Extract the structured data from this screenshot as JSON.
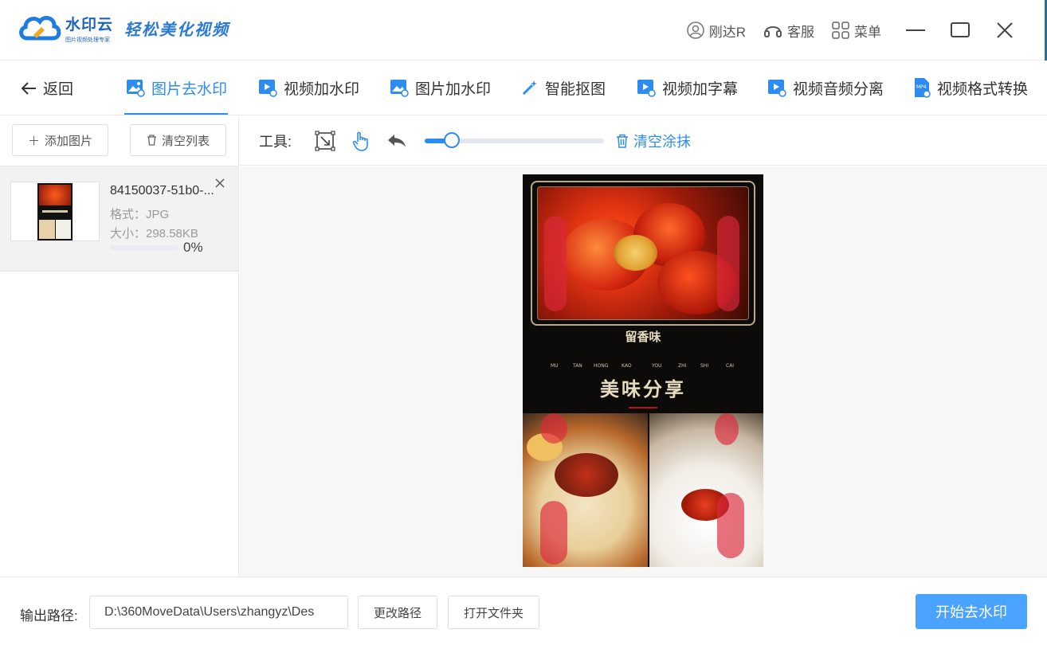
{
  "app": {
    "name": "水印云",
    "subtitle": "图片视频处理专家",
    "slogan": "轻松美化视频"
  },
  "topbar": {
    "user": "刚达R",
    "service": "客服",
    "menu": "菜单"
  },
  "nav": {
    "back": "返回",
    "tabs": [
      {
        "label": "图片去水印",
        "icon": "image-remove-icon",
        "active": true
      },
      {
        "label": "视频加水印",
        "icon": "video-add-icon"
      },
      {
        "label": "图片加水印",
        "icon": "image-add-icon"
      },
      {
        "label": "智能抠图",
        "icon": "magic-wand-icon"
      },
      {
        "label": "视频加字幕",
        "icon": "video-subtitle-icon"
      },
      {
        "label": "视频音频分离",
        "icon": "video-audio-icon"
      },
      {
        "label": "视频格式转换",
        "icon": "mp4-icon"
      }
    ]
  },
  "leftpanel": {
    "add_label": "添加图片",
    "clear_label": "清空列表",
    "files": [
      {
        "name": "84150037-51b0-...",
        "format": "格式：JPG",
        "size": "大小：298.58KB",
        "progress": 0,
        "progress_text": "0%"
      }
    ]
  },
  "toolbar": {
    "label": "工具:",
    "slider_value": 0.15,
    "clear_label": "清空涂抹"
  },
  "poster": {
    "title_small": "留香味",
    "pinyin": [
      "MU",
      "TAN",
      "HONG",
      "KAO",
      "YOU",
      "ZHI",
      "SHI",
      "CAI"
    ],
    "title_big": "美味分享"
  },
  "bottombar": {
    "output_label": "输出路径:",
    "output_path": "D:\\360MoveData\\Users\\zhangyz\\Des",
    "change_path": "更改路径",
    "open_folder": "打开文件夹",
    "start": "开始去水印"
  },
  "colors": {
    "accent": "#2d8cf0",
    "start_button": "#4aa3ff"
  }
}
